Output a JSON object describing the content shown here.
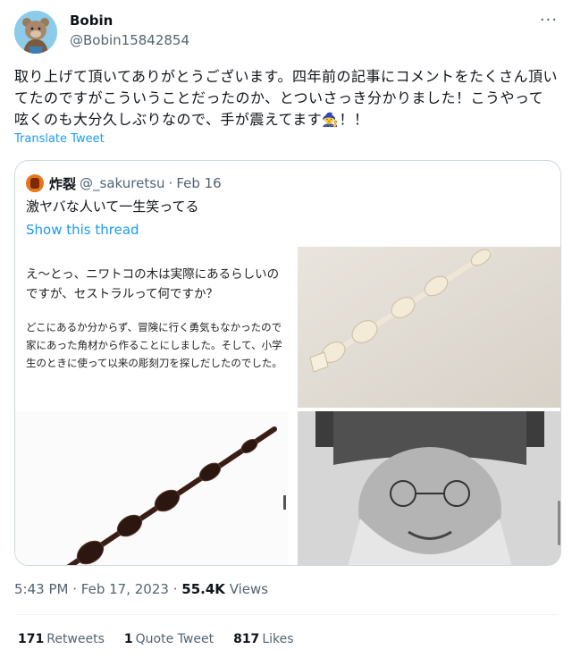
{
  "author": {
    "name": "Bobin",
    "handle": "@Bobin15842854",
    "more_icon": "ellipsis-icon"
  },
  "tweet": {
    "text": "取り上げて頂いてありがとうございます。四年前の記事にコメントをたくさん頂いてたのですがこういうことだったのか、とついさっき分かりました！こうやって呟くのも大分久しぶりなので、手が震えてます",
    "emoji": "🧙",
    "tail": "！！",
    "translate_label": "Translate Tweet"
  },
  "quote": {
    "name": "炸裂",
    "handle": "@_sakuretsu",
    "separator": "·",
    "date": "Feb 16",
    "text": "激ヤバな人いて一生笑ってる",
    "show_thread": "Show this thread",
    "image_text": {
      "title": "え〜とっ、ニワトコの木は実際にあるらしいのですが、セストラルって何ですか？",
      "body": "どこにあるか分からず、冒険に行く勇気もなかったので家にあった角材から作ることにしました。そして、小学生のときに使って以来の彫刻刀を探しだしたのでした。"
    }
  },
  "meta": {
    "time": "5:43 PM",
    "separator": "·",
    "date": "Feb 17, 2023",
    "separator2": "·",
    "views_count": "55.4K",
    "views_label": "Views"
  },
  "stats": {
    "retweets_count": "171",
    "retweets_label": "Retweets",
    "quotes_count": "1",
    "quotes_label": "Quote Tweet",
    "likes_count": "817",
    "likes_label": "Likes"
  }
}
